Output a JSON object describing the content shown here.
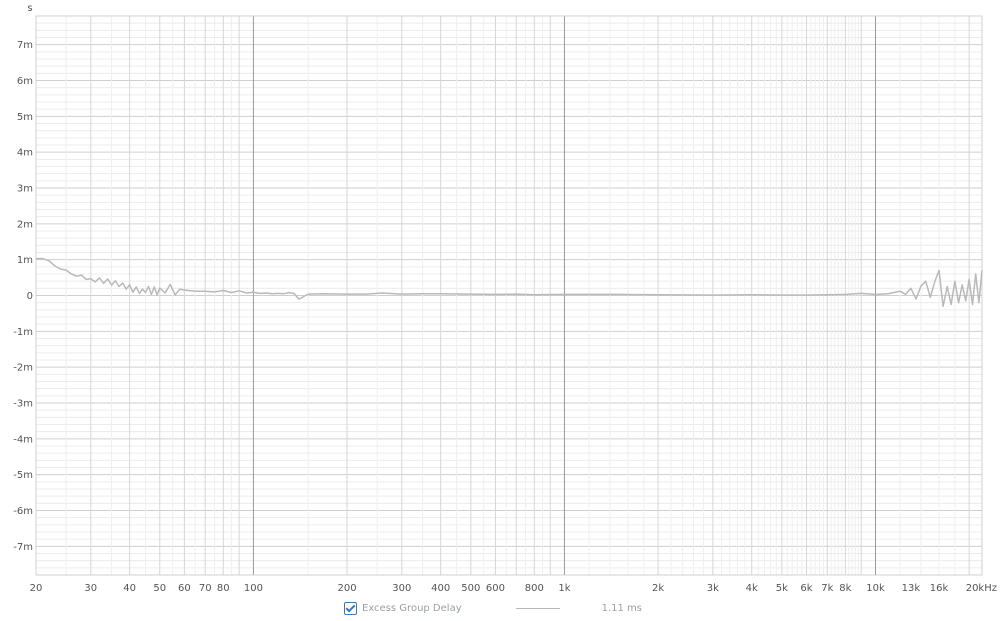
{
  "chart_data": {
    "type": "line",
    "title": "",
    "ylabel": "s",
    "xlabel": "",
    "x_scale": "log",
    "xlim": [
      20,
      22000
    ],
    "ylim": [
      -0.0078,
      0.0078
    ],
    "grid": true,
    "x_tick_labels": [
      "20",
      "30",
      "40",
      "50",
      "60",
      "70",
      "80",
      "100",
      "200",
      "300",
      "400",
      "500",
      "600",
      "800",
      "1k",
      "2k",
      "3k",
      "4k",
      "5k",
      "6k",
      "7k",
      "8k",
      "10k",
      "13k",
      "16k",
      "20kHz"
    ],
    "x_tick_values": [
      20,
      30,
      40,
      50,
      60,
      70,
      80,
      100,
      200,
      300,
      400,
      500,
      600,
      800,
      1000,
      2000,
      3000,
      4000,
      5000,
      6000,
      7000,
      8000,
      10000,
      13000,
      16000,
      20000
    ],
    "y_tick_labels": [
      "7m",
      "6m",
      "5m",
      "4m",
      "3m",
      "2m",
      "1m",
      "0",
      "-1m",
      "-2m",
      "-3m",
      "-4m",
      "-5m",
      "-6m",
      "-7m"
    ],
    "y_tick_values": [
      0.007,
      0.006,
      0.005,
      0.004,
      0.003,
      0.002,
      0.001,
      0,
      -0.001,
      -0.002,
      -0.003,
      -0.004,
      -0.005,
      -0.006,
      -0.007
    ],
    "series": [
      {
        "name": "Excess Group Delay",
        "color": "#b9b9b9",
        "x": [
          20,
          21,
          22,
          23,
          24,
          25,
          26,
          27,
          28,
          29,
          30,
          31,
          32,
          33,
          34,
          35,
          36,
          37,
          38,
          39,
          40,
          41,
          42,
          43,
          44,
          45,
          46,
          47,
          48,
          49,
          50,
          52,
          54,
          56,
          58,
          60,
          63,
          66,
          70,
          75,
          80,
          85,
          90,
          95,
          100,
          105,
          110,
          115,
          120,
          125,
          130,
          135,
          140,
          150,
          170,
          200,
          230,
          260,
          300,
          350,
          400,
          500,
          600,
          700,
          800,
          1000,
          1500,
          2000,
          3000,
          4000,
          5000,
          6000,
          7000,
          8000,
          9000,
          10000,
          11000,
          12000,
          12500,
          13000,
          13500,
          14000,
          14500,
          15000,
          15500,
          16000,
          16500,
          17000,
          17500,
          18000,
          18500,
          19000,
          19500,
          20000,
          20500,
          21000,
          21500,
          22000
        ],
        "values": [
          0.00103,
          0.00103,
          0.00097,
          0.00082,
          0.00074,
          0.00071,
          0.0006,
          0.00054,
          0.00057,
          0.00045,
          0.00047,
          0.00038,
          0.00049,
          0.00034,
          0.00046,
          0.00029,
          0.00041,
          0.00025,
          0.00035,
          0.00018,
          0.0003,
          9e-05,
          0.00024,
          6e-05,
          0.00018,
          8e-05,
          0.00025,
          3e-05,
          0.00024,
          2e-05,
          0.00021,
          7e-05,
          0.00031,
          2e-05,
          0.00018,
          0.00015,
          0.00013,
          0.00012,
          0.00012,
          0.0001,
          0.00014,
          8e-05,
          0.00013,
          7e-05,
          9e-05,
          6e-05,
          7e-05,
          5e-05,
          6e-05,
          5e-05,
          8e-05,
          6e-05,
          -0.0001,
          4e-05,
          5e-05,
          4e-05,
          4e-05,
          7e-05,
          4e-05,
          5e-05,
          5e-05,
          4e-05,
          3e-05,
          4e-05,
          2e-05,
          3e-05,
          3e-05,
          2e-05,
          1e-05,
          2e-05,
          1e-05,
          1e-05,
          2e-05,
          3e-05,
          6e-05,
          3e-05,
          5e-05,
          0.00012,
          3e-05,
          0.0002,
          -0.0001,
          0.00026,
          0.0004,
          -5e-05,
          0.00038,
          0.0007,
          -0.0003,
          0.00025,
          -0.00025,
          0.0004,
          -0.0002,
          0.0003,
          -0.00015,
          0.00045,
          -0.00025,
          0.0006,
          -0.0002,
          0.0007
        ]
      }
    ]
  },
  "legend": {
    "label": "Excess Group Delay",
    "value": "1.11 ms",
    "checked": true
  }
}
